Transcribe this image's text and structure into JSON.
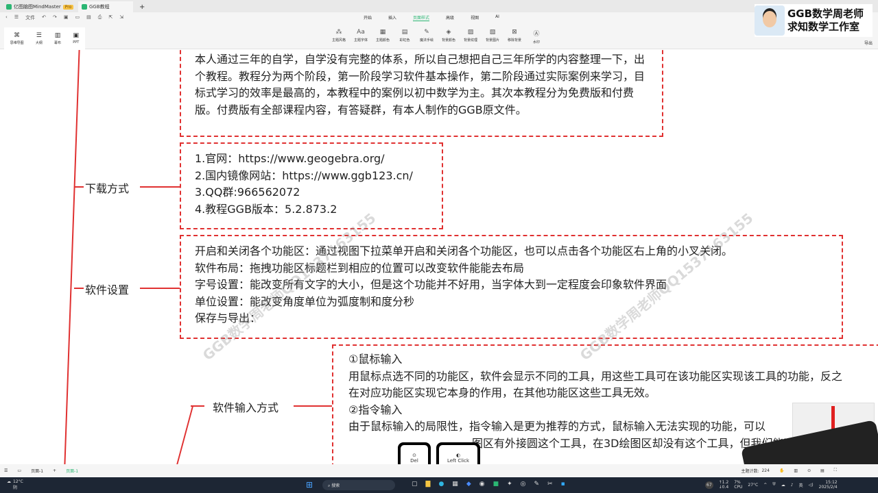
{
  "tabs": [
    {
      "label": "亿图脑图MindMaster",
      "badge": "Pro"
    },
    {
      "label": "GGB教程"
    }
  ],
  "quick_access": {
    "file": "文件"
  },
  "view_modes": [
    {
      "icon": "⌘",
      "label": "思维导图"
    },
    {
      "icon": "☰",
      "label": "大纲"
    },
    {
      "icon": "▥",
      "label": "幕布"
    },
    {
      "icon": "▣",
      "label": "PPT"
    }
  ],
  "menu_tabs": [
    "开始",
    "插入",
    "页面样式",
    "高级",
    "视图",
    "AI"
  ],
  "active_menu": "页面样式",
  "tools": [
    {
      "icon": "⁂",
      "label": "主题风格"
    },
    {
      "icon": "Aa",
      "label": "主题字体"
    },
    {
      "icon": "▦",
      "label": "主题颜色"
    },
    {
      "icon": "▤",
      "label": "彩虹色"
    },
    {
      "icon": "✎",
      "label": "魔法手绘"
    },
    {
      "icon": "◈",
      "label": "背景颜色"
    },
    {
      "icon": "▨",
      "label": "背景纹理"
    },
    {
      "icon": "▧",
      "label": "背景图片"
    },
    {
      "icon": "⊠",
      "label": "移除背景"
    },
    {
      "icon": "Ⓐ",
      "label": "水印"
    }
  ],
  "export": "导出",
  "brand": {
    "line1": "GGB数学周老师",
    "line2": "求知数学工作室"
  },
  "mindmap": {
    "intro": "本人通过三年的自学，自学没有完整的体系，所以自己想把自己三年所学的内容整理一下，出个教程。教程分为两个阶段，第一阶段学习软件基本操作，第二阶段通过实际案例来学习，目标式学习的效率是最高的，本教程中的案例以初中数学为主。其次本教程分为免费版和付费版。付费版有全部课程内容，有答疑群，有本人制作的GGB原文件。",
    "download": {
      "label": "下载方式",
      "lines": [
        "1.官网：https://www.geogebra.org/",
        "2.国内镜像网站：https://www.ggb123.cn/",
        "3.QQ群:966562072",
        "4.教程GGB版本：5.2.873.2"
      ]
    },
    "settings": {
      "label": "软件设置",
      "lines": [
        "开启和关闭各个功能区：通过视图下拉菜单开启和关闭各个功能区，也可以点击各个功能区右上角的小叉关闭。",
        "软件布局：拖拽功能区标题栏到相应的位置可以改变软件能能去布局",
        "字号设置：能改变所有文字的大小，但是这个功能并不好用，当字体大到一定程度会印象软件界面",
        "单位设置：能改变角度单位为弧度制和度分秒",
        "保存与导出："
      ]
    },
    "input": {
      "label": "软件输入方式",
      "lines": [
        "①鼠标输入",
        "用鼠标点选不同的功能区，软件会显示不同的工具，用这些工具可在该功能区实现该工具的功能，反之",
        "在对应功能区实现它本身的作用，在其他功能区这些工具无效。",
        "②指令输入",
        "由于鼠标输入的局限性，指令输入是更为推荐的方式，鼠标输入无法实现的功能，可以",
        "图区有外接圆这个工具，在3D绘图区却没有这个工具，但我们能通过指令"
      ]
    }
  },
  "watermark": "GGB数学周老师QQ1537163155",
  "keys": [
    {
      "icon": "⊙",
      "label": "Del"
    },
    {
      "icon": "◐",
      "label": "Left Click"
    }
  ],
  "status": {
    "page": "页面-1",
    "page_tab": "页面-1",
    "topic_count_label": "主题计数:",
    "topic_count": "224"
  },
  "taskbar": {
    "temp": "12°C",
    "weather": "阴",
    "search": "搜索",
    "cpu_temp": "67",
    "net_up": "↑1.2",
    "net_down": "↓0.4",
    "cpu": "7%",
    "cpu_label": "CPU",
    "temp2": "27°C",
    "ime": "英",
    "time": "15:12",
    "date": "2025/2/4"
  }
}
